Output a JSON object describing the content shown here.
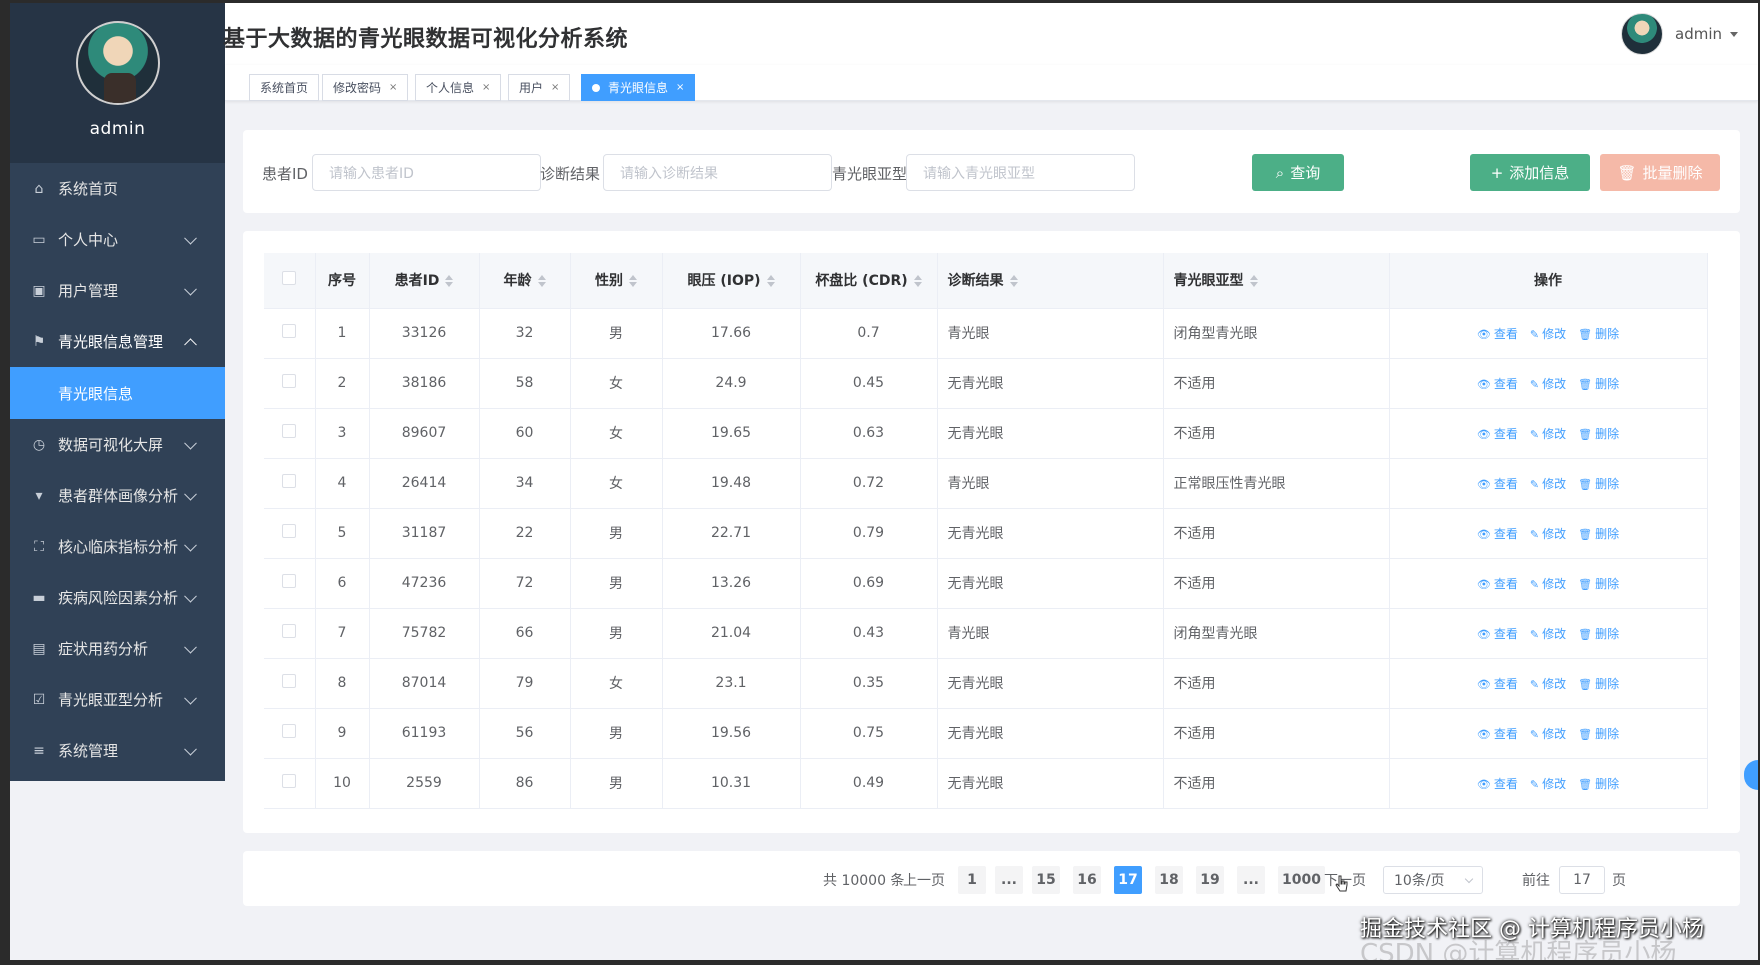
{
  "header": {
    "title": "基于大数据的青光眼数据可视化分析系统",
    "user": "admin"
  },
  "sidebar": {
    "username": "admin",
    "items": [
      {
        "label": "系统首页",
        "icon": "home-icon"
      },
      {
        "label": "个人中心",
        "icon": "card-icon"
      },
      {
        "label": "用户管理",
        "icon": "clipboard-icon"
      },
      {
        "label": "青光眼信息管理",
        "icon": "flag-icon"
      },
      {
        "label": "数据可视化大屏",
        "icon": "dashboard-icon"
      },
      {
        "label": "患者群体画像分析",
        "icon": "pin-icon"
      },
      {
        "label": "核心临床指标分析",
        "icon": "fullscreen-icon"
      },
      {
        "label": "疾病风险因素分析",
        "icon": "monitor-icon"
      },
      {
        "label": "症状用药分析",
        "icon": "doc-icon"
      },
      {
        "label": "青光眼亚型分析",
        "icon": "checklist-icon"
      },
      {
        "label": "系统管理",
        "icon": "menu-icon"
      }
    ],
    "active_sub": "青光眼信息"
  },
  "tags": [
    {
      "label": "系统首页"
    },
    {
      "label": "修改密码",
      "close": "×"
    },
    {
      "label": "个人信息",
      "close": "×"
    },
    {
      "label": "用户",
      "close": "×"
    },
    {
      "label": "青光眼信息",
      "close": "×"
    }
  ],
  "search": {
    "patient_label": "患者ID",
    "patient_placeholder": "请输入患者ID",
    "diag_label": "诊断结果",
    "diag_placeholder": "请输入诊断结果",
    "subtype_label": "青光眼亚型",
    "subtype_placeholder": "请输入青光眼亚型",
    "query_btn": "查询",
    "add_btn": "添加信息",
    "batch_del_btn": "批量删除"
  },
  "table": {
    "headers": [
      "序号",
      "患者ID",
      "年龄",
      "性别",
      "眼压 (IOP)",
      "杯盘比 (CDR)",
      "诊断结果",
      "青光眼亚型",
      "操作"
    ],
    "actions": {
      "view": "查看",
      "edit": "修改",
      "delete": "删除"
    },
    "rows": [
      [
        "1",
        "33126",
        "32",
        "男",
        "17.66",
        "0.7",
        "青光眼",
        "闭角型青光眼"
      ],
      [
        "2",
        "38186",
        "58",
        "女",
        "24.9",
        "0.45",
        "无青光眼",
        "不适用"
      ],
      [
        "3",
        "89607",
        "60",
        "女",
        "19.65",
        "0.63",
        "无青光眼",
        "不适用"
      ],
      [
        "4",
        "26414",
        "34",
        "女",
        "19.48",
        "0.72",
        "青光眼",
        "正常眼压性青光眼"
      ],
      [
        "5",
        "31187",
        "22",
        "男",
        "22.71",
        "0.79",
        "无青光眼",
        "不适用"
      ],
      [
        "6",
        "47236",
        "72",
        "男",
        "13.26",
        "0.69",
        "无青光眼",
        "不适用"
      ],
      [
        "7",
        "75782",
        "66",
        "男",
        "21.04",
        "0.43",
        "青光眼",
        "闭角型青光眼"
      ],
      [
        "8",
        "87014",
        "79",
        "女",
        "23.1",
        "0.35",
        "无青光眼",
        "不适用"
      ],
      [
        "9",
        "61193",
        "56",
        "男",
        "19.56",
        "0.75",
        "无青光眼",
        "不适用"
      ],
      [
        "10",
        "2559",
        "86",
        "男",
        "10.31",
        "0.49",
        "无青光眼",
        "不适用"
      ]
    ]
  },
  "pagination": {
    "total": "共 10000 条",
    "prev": "上一页",
    "next": "下一页",
    "pages": [
      "1",
      "...",
      "15",
      "16",
      "17",
      "18",
      "19",
      "...",
      "1000"
    ],
    "current": "17",
    "page_size": "10条/页",
    "goto_label": "前往",
    "goto_value": "17",
    "goto_suffix": "页"
  },
  "watermark": {
    "line1": "掘金技术社区 @ 计算机程序员小杨",
    "line2": "CSDN @计算机程序员小杨"
  }
}
